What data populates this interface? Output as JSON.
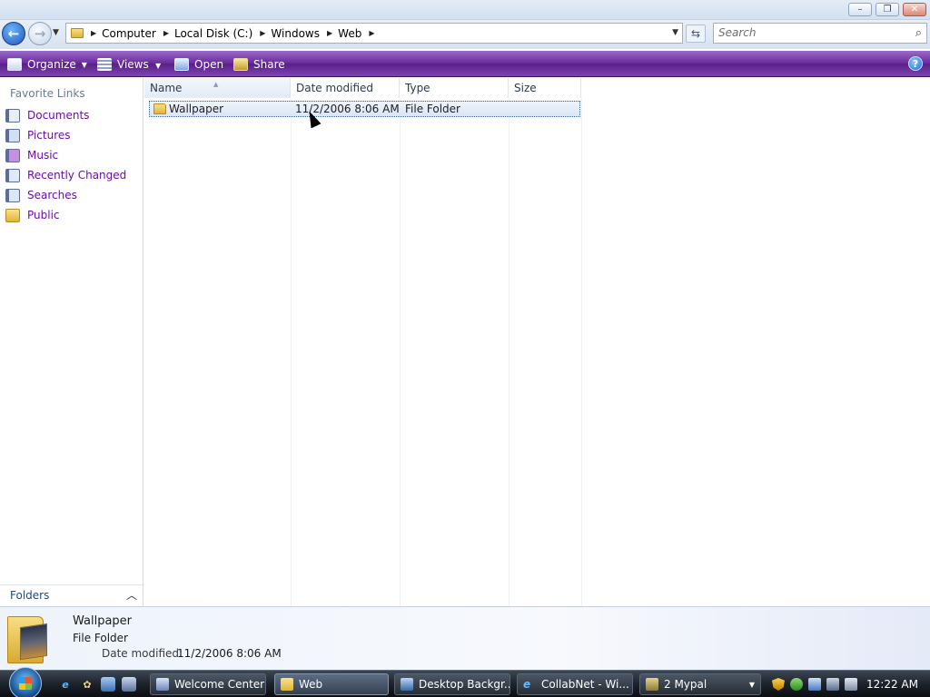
{
  "window": {
    "controls": {
      "minimize": "–",
      "maximize": "❐",
      "close": "✕"
    }
  },
  "address_bar": {
    "crumbs": [
      "Computer",
      "Local Disk (C:)",
      "Windows",
      "Web"
    ],
    "search_placeholder": "Search"
  },
  "toolbar": {
    "organize_label": "Organize",
    "views_label": "Views",
    "open_label": "Open",
    "share_label": "Share"
  },
  "nav_pane": {
    "favorites_heading": "Favorite Links",
    "favorites": [
      {
        "label": "Documents",
        "icon": "documents-icon"
      },
      {
        "label": "Pictures",
        "icon": "pictures-icon"
      },
      {
        "label": "Music",
        "icon": "music-icon"
      },
      {
        "label": "Recently Changed",
        "icon": "recently-changed-icon"
      },
      {
        "label": "Searches",
        "icon": "searches-icon"
      },
      {
        "label": "Public",
        "icon": "public-folder-icon"
      }
    ],
    "folders_label": "Folders"
  },
  "file_list": {
    "columns": [
      "Name",
      "Date modified",
      "Type",
      "Size"
    ],
    "rows": [
      {
        "name": "Wallpaper",
        "date_modified": "11/2/2006 8:06 AM",
        "type": "File Folder",
        "size": ""
      }
    ]
  },
  "details_pane": {
    "name": "Wallpaper",
    "type": "File Folder",
    "date_label": "Date modified:",
    "date_value": "11/2/2006 8:06 AM"
  },
  "taskbar": {
    "tasks": [
      {
        "label": "Welcome Center"
      },
      {
        "label": "Web"
      },
      {
        "label": "Desktop Backgr..."
      },
      {
        "label": "CollabNet - Wi..."
      },
      {
        "label": "2 Mypal"
      }
    ],
    "clock": "12:22 AM"
  }
}
